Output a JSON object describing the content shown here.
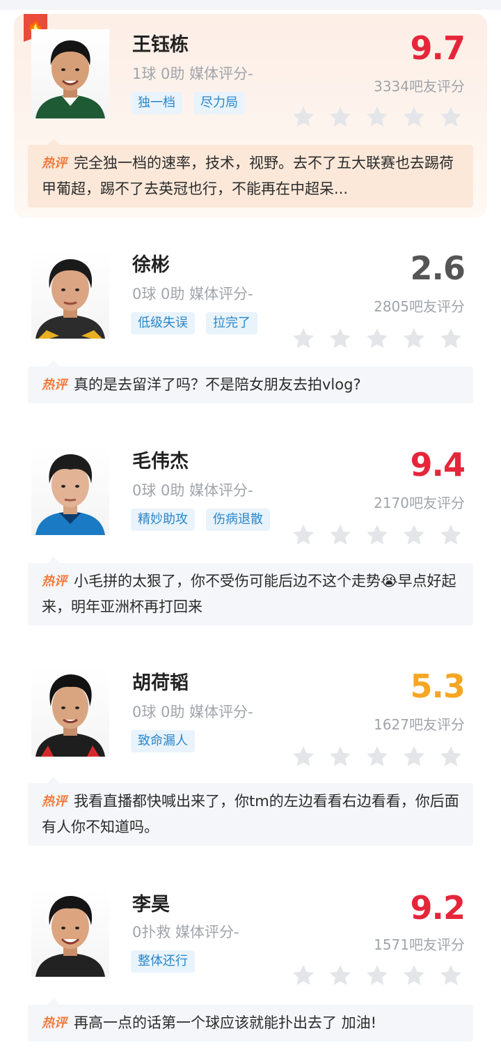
{
  "colors": {
    "high": "#e5263a",
    "low": "#555555",
    "mid": "#f5a623",
    "tag_bg": "#e9f3fb",
    "tag_text": "#2a86c9",
    "star": "#e3e5e9"
  },
  "comment_prefix": "热评",
  "players": [
    {
      "name": "王钰栋",
      "stats": "1球 0助  媒体评分-",
      "tags": [
        "独一档",
        "尽力局"
      ],
      "score": "9.7",
      "score_color": "#e5263a",
      "votes": "3334吧友评分",
      "stars_filled": 0,
      "hot_badge_icon": "flame-icon",
      "comment": "完全独一档的速率，技术，视野。去不了五大联赛也去踢荷甲葡超，踢不了去英冠也行，不能再在中超呆..."
    },
    {
      "name": "徐彬",
      "stats": "0球 0助  媒体评分-",
      "tags": [
        "低级失误",
        "拉完了"
      ],
      "score": "2.6",
      "score_color": "#555555",
      "votes": "2805吧友评分",
      "stars_filled": 0,
      "comment": "真的是去留洋了吗？不是陪女朋友去拍vlog?"
    },
    {
      "name": "毛伟杰",
      "stats": "0球 0助  媒体评分-",
      "tags": [
        "精妙助攻",
        "伤病退散"
      ],
      "score": "9.4",
      "score_color": "#e5263a",
      "votes": "2170吧友评分",
      "stars_filled": 0,
      "comment": "小毛拼的太狠了，你不受伤可能后边不这个走势😭早点好起来，明年亚洲杯再打回来"
    },
    {
      "name": "胡荷韬",
      "stats": "0球 0助  媒体评分-",
      "tags": [
        "致命漏人"
      ],
      "score": "5.3",
      "score_color": "#f5a623",
      "votes": "1627吧友评分",
      "stars_filled": 0,
      "comment": "我看直播都快喊出来了，你tm的左边看看右边看看，你后面有人你不知道吗。"
    },
    {
      "name": "李昊",
      "stats": "0扑救  媒体评分-",
      "tags": [
        "整体还行"
      ],
      "score": "9.2",
      "score_color": "#e5263a",
      "votes": "1571吧友评分",
      "stars_filled": 0,
      "comment": "再高一点的话第一个球应该就能扑出去了 加油!"
    }
  ]
}
